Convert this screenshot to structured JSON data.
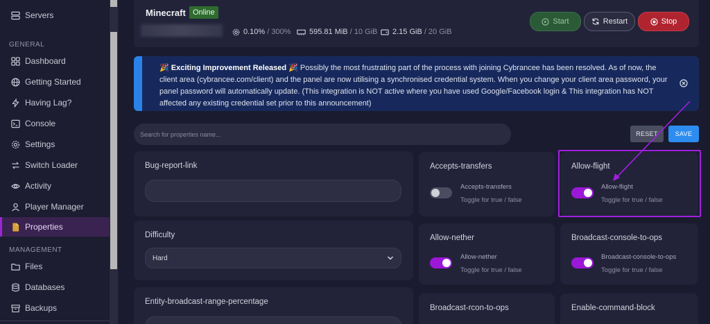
{
  "sidebar": {
    "items_top": [
      {
        "label": "Servers",
        "icon": "server-icon"
      }
    ],
    "general_heading": "GENERAL",
    "general": [
      {
        "label": "Dashboard",
        "icon": "dashboard-icon"
      },
      {
        "label": "Getting Started",
        "icon": "globe-icon"
      },
      {
        "label": "Having Lag?",
        "icon": "lightning-icon"
      },
      {
        "label": "Console",
        "icon": "terminal-icon"
      },
      {
        "label": "Settings",
        "icon": "gear-icon"
      },
      {
        "label": "Switch Loader",
        "icon": "switch-icon"
      },
      {
        "label": "Activity",
        "icon": "eye-icon"
      },
      {
        "label": "Player Manager",
        "icon": "user-icon"
      },
      {
        "label": "Properties",
        "icon": "file-icon",
        "active": true
      }
    ],
    "management_heading": "MANAGEMENT",
    "management": [
      {
        "label": "Files",
        "icon": "folder-icon"
      },
      {
        "label": "Databases",
        "icon": "database-icon"
      },
      {
        "label": "Backups",
        "icon": "archive-icon"
      }
    ]
  },
  "header": {
    "server_name": "Minecraft",
    "status": "Online",
    "cpu": "0.10%",
    "cpu_limit": "/ 300%",
    "memory": "595.81 MiB",
    "memory_limit": "/ 10 GiB",
    "disk": "2.15 GiB",
    "disk_limit": "/ 20 GiB",
    "start_label": "Start",
    "restart_label": "Restart",
    "stop_label": "Stop"
  },
  "announcement": {
    "title": "Exciting Improvement Released",
    "body": "Possibly the most frustrating part of the process with joining Cybrancee has been resolved. As of now, the client area (cybrancee.com/client) and the panel are now utilising a synchronised credential system. When you change your client area password, your panel password will automatically update. (This integration is NOT active where you have used Google/Facebook login & This integration has NOT affected any existing credential set prior to this announcement)"
  },
  "search": {
    "placeholder": "Search for properties name..."
  },
  "actions": {
    "reset_label": "RESET",
    "save_label": "SAVE"
  },
  "properties": {
    "bug_report_link": {
      "title": "Bug-report-link",
      "value": ""
    },
    "difficulty": {
      "title": "Difficulty",
      "value": "Hard"
    },
    "entity_broadcast": {
      "title": "Entity-broadcast-range-percentage"
    },
    "accepts_transfers": {
      "title": "Accepts-transfers",
      "label": "Accepts-transfers",
      "hint": "Toggle for true / false",
      "on": false
    },
    "allow_flight": {
      "title": "Allow-flight",
      "label": "Allow-flight",
      "hint": "Toggle for true / false",
      "on": true
    },
    "allow_nether": {
      "title": "Allow-nether",
      "label": "Allow-nether",
      "hint": "Toggle for true / false",
      "on": true
    },
    "broadcast_console": {
      "title": "Broadcast-console-to-ops",
      "label": "Broadcast-console-to-ops",
      "hint": "Toggle for true / false",
      "on": true
    },
    "broadcast_rcon": {
      "title": "Broadcast-rcon-to-ops"
    },
    "enable_command_block": {
      "title": "Enable-command-block"
    }
  },
  "colors": {
    "accent": "#9b18d6",
    "save": "#2d8cf0",
    "stop": "#b02430",
    "start": "#2b5a37",
    "online": "#2f6b2f"
  }
}
